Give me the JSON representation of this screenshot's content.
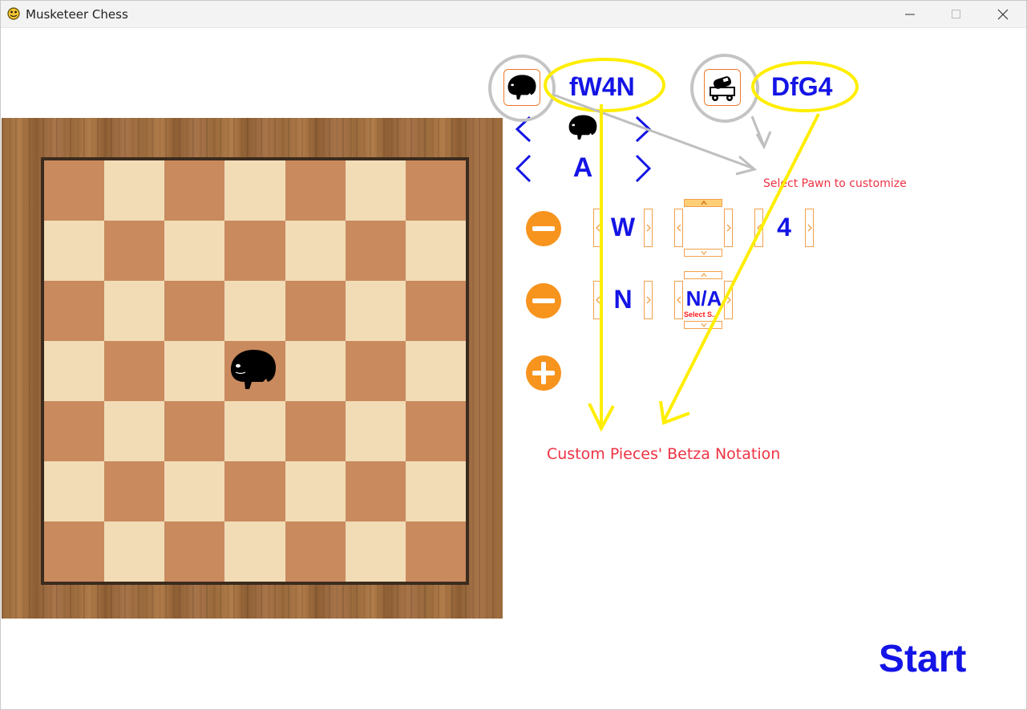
{
  "window": {
    "title": "Musketeer Chess",
    "controls": [
      "minimize",
      "maximize",
      "close"
    ]
  },
  "pieces": [
    {
      "notation": "fW4N",
      "icon": "hippo-piece-icon"
    },
    {
      "notation": "DfG4",
      "icon": "cannon-cart-piece-icon"
    }
  ],
  "selector": {
    "current_piece_icon": "hippo-piece-icon",
    "current_letter": "A"
  },
  "moves": [
    {
      "atom": "W",
      "direction": "",
      "range": "4"
    },
    {
      "atom": "N",
      "direction": "N/A",
      "direction_hint": "Select S...",
      "range": ""
    }
  ],
  "annotations": {
    "select_pawn": "Select Pawn to customize",
    "betza_note": "Custom Pieces' Betza Notation"
  },
  "start_label": "Start",
  "colors": {
    "blue_text": "#1414e6",
    "orange_button": "#f7941d",
    "highlight_yellow": "#ffee00",
    "annotation_red": "#ee3344",
    "board_dark": "#c98a5e",
    "board_light": "#f1dcb6"
  }
}
